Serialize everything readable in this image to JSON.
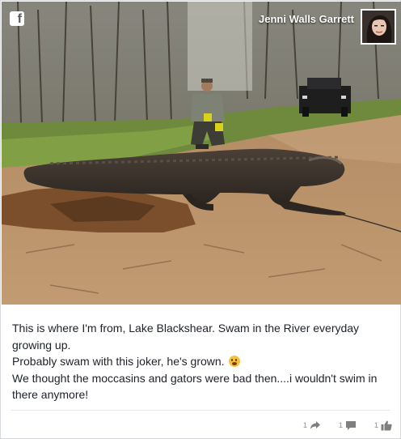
{
  "header": {
    "brand_icon": "facebook-f-icon",
    "author_name": "Jenni Walls Garrett"
  },
  "post": {
    "lines": [
      "This is where I'm from, Lake Blackshear. Swam in the River everyday growing up.",
      "Probably swam with this joker, he's grown.",
      "We thought the moccasins and gators were bad then....i wouldn't swim in there anymore!"
    ],
    "emoji": "flushed-face-emoji"
  },
  "actions": {
    "share": {
      "icon": "share-arrow-icon",
      "count": "1"
    },
    "comment": {
      "icon": "comment-bubble-icon",
      "count": "1"
    },
    "like": {
      "icon": "thumbs-up-icon",
      "count": "1"
    }
  },
  "colors": {
    "text": "#1d2129",
    "muted": "#7f7f7f",
    "border": "#d6d9dd"
  }
}
